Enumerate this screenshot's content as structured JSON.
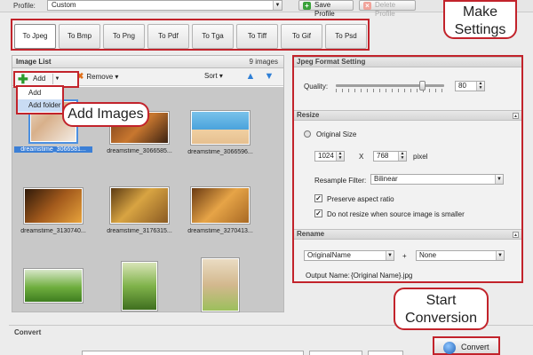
{
  "profile": {
    "label": "Profile:",
    "value": "Custom"
  },
  "toolbar": {
    "save_profile": "Save Profile",
    "delete_profile": "Delete Profile"
  },
  "tabs": [
    "To Jpeg",
    "To Bmp",
    "To Png",
    "To Pdf",
    "To Tga",
    "To Tiff",
    "To Gif",
    "To Psd"
  ],
  "image_list": {
    "title": "Image List",
    "count": "9 images",
    "add_label": "Add",
    "remove_label": "Remove",
    "sort_label": "Sort",
    "add_menu": [
      "Add",
      "Add folder"
    ],
    "thumbnails": [
      "dreamstime_3066581...",
      "dreamstime_3066585...",
      "dreamstime_3066596...",
      "dreamstime_3130740...",
      "dreamstime_3176315...",
      "dreamstime_3270413...",
      "",
      "",
      ""
    ]
  },
  "settings": {
    "jpeg_title": "Jpeg Format Setting",
    "quality_label": "Quality:",
    "quality_value": "80",
    "quality": 80,
    "resize_title": "Resize",
    "original_size": "Original Size",
    "width": "1024",
    "x_sep": "X",
    "height": "768",
    "unit": "pixel",
    "resample_label": "Resample Filter:",
    "resample_value": "Bilinear",
    "preserve_aspect": "Preserve aspect ratio",
    "no_resize_smaller": "Do not resize when source image is smaller",
    "rename_title": "Rename",
    "rename_value": "OriginalName",
    "plus": "+",
    "rename_suffix": "None",
    "output_label": "Output Name:",
    "output_value": "{Original Name}.jpg"
  },
  "convert": {
    "title": "Convert",
    "button": "Convert"
  },
  "callouts": {
    "make_settings": "Make Settings",
    "add_images": "Add Images",
    "start_conversion": "Start Conversion"
  },
  "colors": {
    "highlight": "#c2232b",
    "selection": "#3b7fd6"
  }
}
